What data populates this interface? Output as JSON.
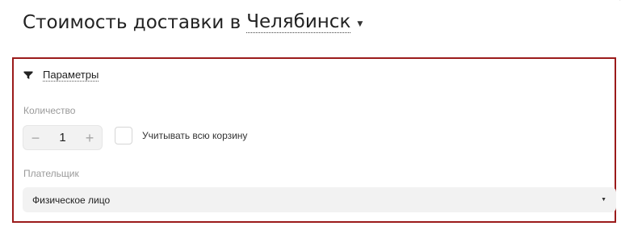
{
  "header": {
    "title": "Стоимость доставки в",
    "city": "Челябинск",
    "caret_icon": "caret-down-icon",
    "corner_mark": "′"
  },
  "panel": {
    "border_color": "#9b1b1b",
    "toggle_label": "Параметры",
    "toggle_icon": "filter-icon",
    "quantity": {
      "label": "Количество",
      "value": "1",
      "minus": "−",
      "plus": "+"
    },
    "whole_cart": {
      "label": "Учитывать всю корзину",
      "checked": false
    },
    "payer": {
      "label": "Плательщик",
      "selected": "Физическое лицо"
    }
  }
}
